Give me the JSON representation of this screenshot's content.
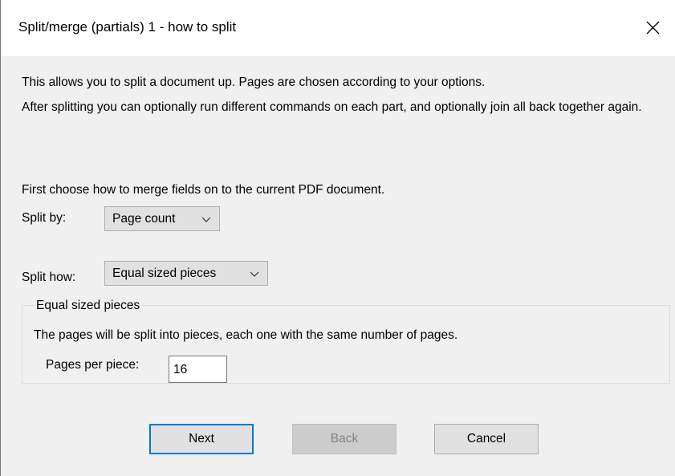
{
  "window": {
    "title": "Split/merge (partials) 1 - how to split"
  },
  "intro": {
    "line1": "This allows you to split a document up. Pages are chosen according to your options.",
    "line2": "After splitting you can optionally run different commands on each part, and optionally join all back together again."
  },
  "merge_instruction": "First choose how to merge fields on to the current PDF document.",
  "split_by": {
    "label": "Split by:",
    "value": "Page count"
  },
  "split_how": {
    "label": "Split how:",
    "value": "Equal sized pieces"
  },
  "group": {
    "title": "Equal sized pieces",
    "description": "The pages will be split into pieces, each one with the same number of pages.",
    "pages_label": "Pages per piece:",
    "pages_value": "16"
  },
  "buttons": {
    "next": "Next",
    "back": "Back",
    "cancel": "Cancel"
  },
  "colors": {
    "accent": "#0078d7",
    "background": "#f0f0f0",
    "titlebar": "#ffffff"
  }
}
